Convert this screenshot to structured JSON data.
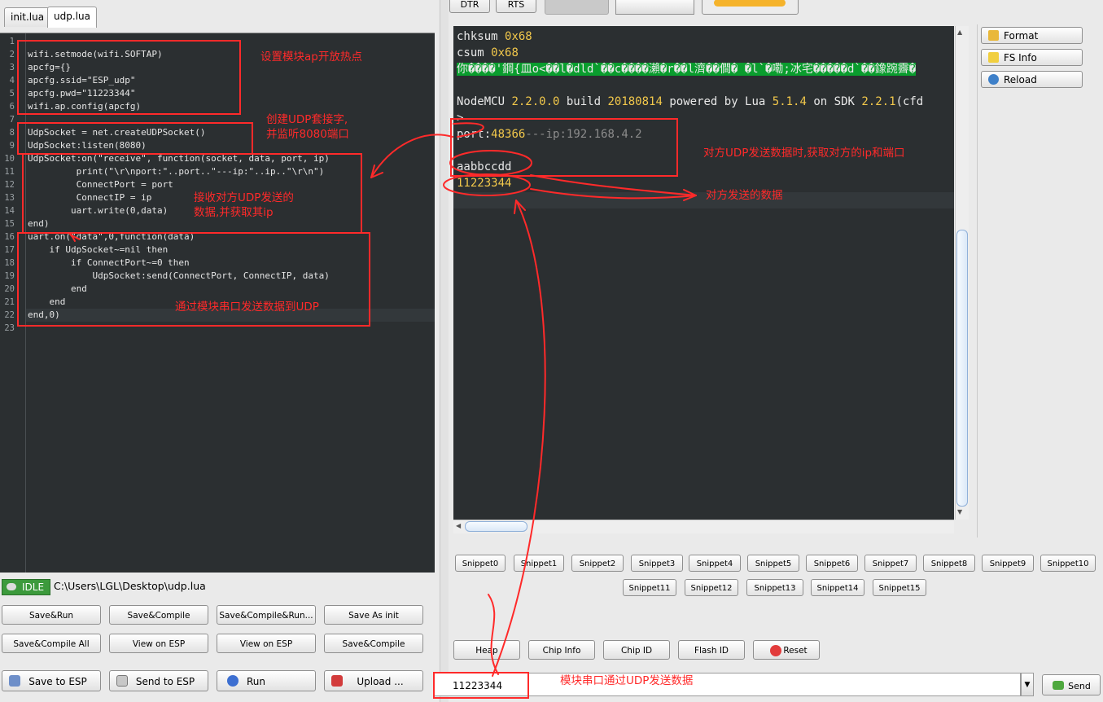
{
  "tabs": [
    {
      "label": "init.lua"
    },
    {
      "label": "udp.lua"
    }
  ],
  "editor": {
    "line_numbers": [
      "1",
      "2",
      "3",
      "4",
      "5",
      "6",
      "7",
      "8",
      "9",
      "10",
      "11",
      "12",
      "13",
      "14",
      "15",
      "16",
      "17",
      "18",
      "19",
      "20",
      "21",
      "22",
      "23"
    ],
    "lines": [
      "",
      "wifi.setmode(wifi.SOFTAP)",
      "apcfg={}",
      "apcfg.ssid=\"ESP_udp\"",
      "apcfg.pwd=\"11223344\"",
      "wifi.ap.config(apcfg)",
      "",
      "UdpSocket = net.createUDPSocket()",
      "UdpSocket:listen(8080)",
      "UdpSocket:on(\"receive\", function(socket, data, port, ip)",
      "         print(\"\\r\\nport:\"..port..\"---ip:\"..ip..\"\\r\\n\")",
      "         ConnectPort = port",
      "         ConnectIP = ip",
      "        uart.write(0,data)",
      "end)",
      "uart.on(\"data\",0,function(data)",
      "    if UdpSocket~=nil then",
      "        if ConnectPort~=0 then",
      "            UdpSocket:send(ConnectPort, ConnectIP, data)",
      "        end",
      "    end",
      "end,0)",
      ""
    ]
  },
  "annotations": {
    "ap": "设置模块ap开放热点",
    "udp_create": "创建UDP套接字,\n并监听8080端口",
    "receive": "接收对方UDP发送的\n数据,并获取其ip",
    "uart_send": "通过模块串口发送数据到UDP",
    "peer_info": "对方UDP发送数据时,获取对方的ip和端口",
    "peer_data": "对方发送的数据",
    "serial_send": "模块串口通过UDP发送数据"
  },
  "status": {
    "state": "IDLE",
    "path": "C:\\Users\\LGL\\Desktop\\udp.lua"
  },
  "left_buttons": {
    "row1": [
      "Save&Run",
      "Save&Compile",
      "Save&Compile&Run...",
      "Save As init"
    ],
    "row2": [
      "Save&Compile All",
      "View on ESP",
      "View on ESP",
      "Save&Compile"
    ],
    "row3": [
      "Save to ESP",
      "Send to ESP",
      "Run",
      "Upload ..."
    ]
  },
  "top_buttons": [
    "DTR",
    "RTS"
  ],
  "terminal": {
    "chksum_label": "chksum",
    "chksum_value": "0x68",
    "csum_label": "csum",
    "csum_value": "0x68",
    "garbage": "你����'鋼{皿o<��l�dld`��c����瀨�r��l濟��僴� �l`�嘞;冰宅�����d`��鐌踠霽�",
    "nodemcu_1": "NodeMCU ",
    "nodemcu_ver": "2.2.0.0",
    "nodemcu_2": " build ",
    "nodemcu_build": "20180814",
    "nodemcu_3": " powered by Lua ",
    "nodemcu_lua": "5.1.4",
    "nodemcu_4": " on SDK ",
    "nodemcu_sdk": "2.2.1",
    "nodemcu_5": "(cfd",
    "prompt": ">",
    "port_label": "port:",
    "port_value": "48366",
    "ip_part": "---ip:192.168.4.2",
    "recv_data": "aabbccdd",
    "send_echo": "11223344"
  },
  "side_buttons": [
    "Format",
    "FS Info",
    "Reload"
  ],
  "snippets": [
    "Snippet0",
    "Snippet1",
    "Snippet2",
    "Snippet3",
    "Snippet4",
    "Snippet5",
    "Snippet6",
    "Snippet7",
    "Snippet8",
    "Snippet9",
    "Snippet10",
    "Snippet11",
    "Snippet12",
    "Snippet13",
    "Snippet14",
    "Snippet15"
  ],
  "bottom_buttons": [
    "Heap",
    "Chip Info",
    "Chip ID",
    "Flash ID",
    "Reset"
  ],
  "command_input": {
    "value": "11223344"
  },
  "send_button": "Send",
  "colors": {
    "annotation": "#ff2a2a",
    "editor_bg": "#2b2f31",
    "number": "#f2c84b"
  }
}
